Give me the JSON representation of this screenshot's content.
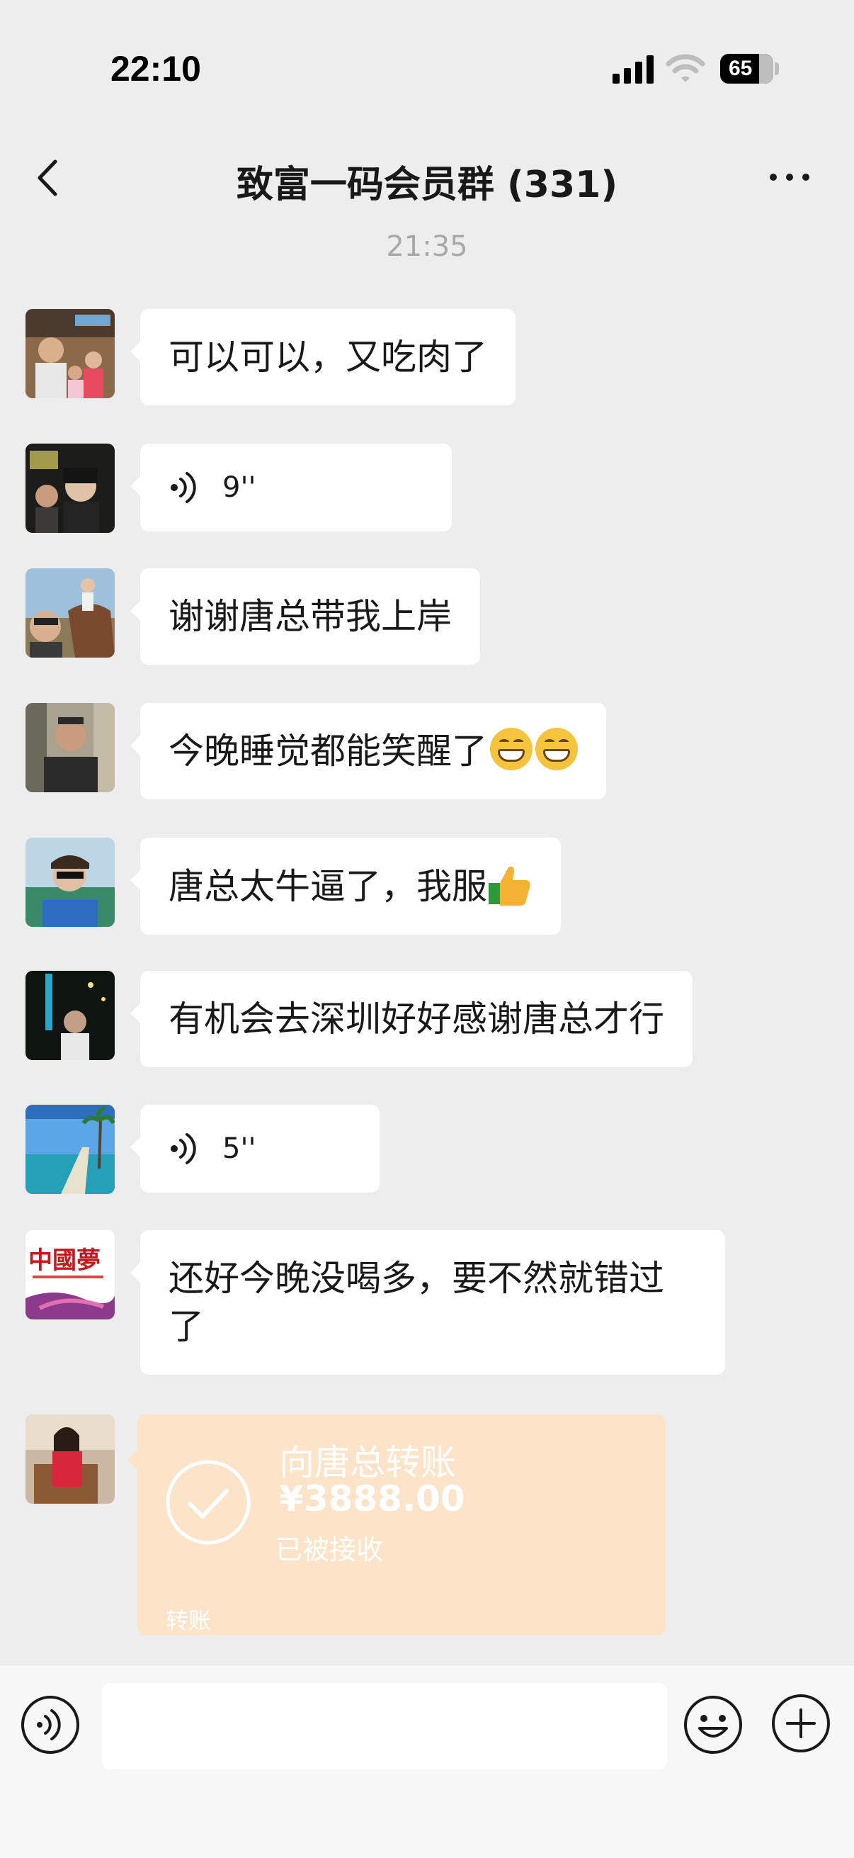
{
  "status_bar": {
    "time": "22:10",
    "battery": "65"
  },
  "header": {
    "title": "致富一码会员群 (331)"
  },
  "timestamp": "21:35",
  "messages": [
    {
      "type": "text",
      "text": "可以可以，又吃肉了"
    },
    {
      "type": "voice",
      "duration": "9''"
    },
    {
      "type": "text",
      "text": "谢谢唐总带我上岸"
    },
    {
      "type": "text",
      "text": "今晚睡觉都能笑醒了",
      "emoji": [
        "grinning-face",
        "grinning-face"
      ]
    },
    {
      "type": "text",
      "text": "唐总太牛逼了，我服",
      "emoji": [
        "thumbs-up"
      ]
    },
    {
      "type": "text",
      "text": "有机会去深圳好好感谢唐总才行"
    },
    {
      "type": "voice",
      "duration": "5''"
    },
    {
      "type": "text",
      "text_line1": "还好今晚没喝多，要不然就错过",
      "text_line2": "了",
      "avatar_text": "中國夢"
    },
    {
      "type": "transfer",
      "title": "向唐总转账",
      "amount": "¥3888.00",
      "status": "已被接收",
      "label": "转账"
    }
  ],
  "input": {
    "placeholder": ""
  },
  "colors": {
    "background": "#ededed",
    "bubble": "#ffffff",
    "transfer": "#fde4c9",
    "text": "#191919"
  }
}
